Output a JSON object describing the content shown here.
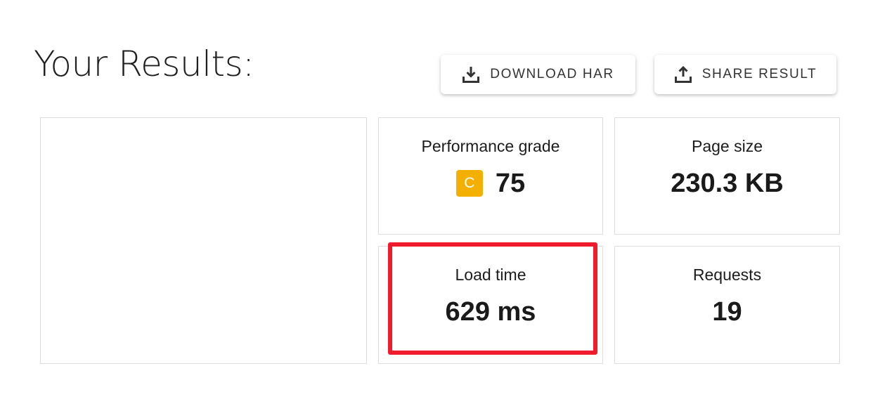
{
  "header": {
    "title": "Your Results:"
  },
  "toolbar": {
    "download_label": "DOWNLOAD HAR",
    "share_label": "SHARE RESULT",
    "download_icon": "download-tray-icon",
    "share_icon": "upload-tray-icon"
  },
  "metrics": {
    "performance": {
      "label": "Performance grade",
      "grade": "C",
      "value": "75",
      "grade_color": "#f4b000"
    },
    "page_size": {
      "label": "Page size",
      "value": "230.3 KB"
    },
    "load_time": {
      "label": "Load time",
      "value": "629 ms"
    },
    "requests": {
      "label": "Requests",
      "value": "19"
    }
  },
  "colors": {
    "highlight": "#f01b2d",
    "card_border": "#dcdcdc",
    "text": "#1c1c1c"
  }
}
